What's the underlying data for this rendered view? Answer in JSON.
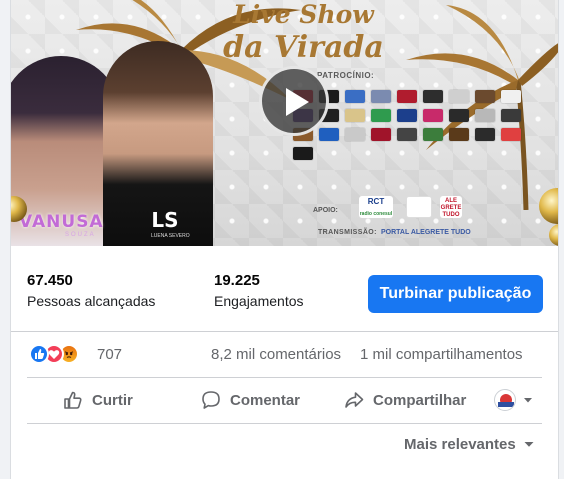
{
  "post": {
    "media": {
      "title_line1": "Live Show",
      "title_line2": "da Virada",
      "sponsor_heading": "PATROCÍNIO:",
      "artist_left": "VANUSA",
      "artist_left_sub": "SOUZA",
      "artist_right_logo": "LS",
      "artist_right_sub": "LUENA SEVERO",
      "support_heading": "APOIO:",
      "broadcast_heading": "TRANSMISSÃO:",
      "broadcast_channel": "PORTAL ALEGRETE TUDO",
      "support_logo_1": "RCT",
      "support_logo_1_sub": "radio conesul",
      "support_logo_3": "ALE GRETE TUDO",
      "play_icon": "play-icon",
      "sponsor_logo_colors": [
        "#c4142b",
        "#1b1b1b",
        "#3a6ec4",
        "#7b8bb0",
        "#b01c2e",
        "#2d2d2d",
        "#cfcfcf",
        "#6b4a2e",
        "#f0f0f0",
        "#4f2d7a",
        "#202020",
        "#d9c48a",
        "#2f9b4e",
        "#1c3f8c",
        "#c82a6a",
        "#2a2a2a",
        "#b8b8b8",
        "#3a3a3a",
        "#8b5a2b",
        "#1f5fbf",
        "#c9c9c9",
        "#a0142a",
        "#444444",
        "#3c7d3c",
        "#5a3a1a",
        "#2b2b2b",
        "#e04040",
        "#1a1a1a"
      ]
    },
    "stats": {
      "reach_value": "67.450",
      "reach_label": "Pessoas alcançadas",
      "engagement_value": "19.225",
      "engagement_label": "Engajamentos",
      "boost_label": "Turbinar publicação"
    },
    "reactions": {
      "icons": [
        "like-reaction-icon",
        "love-reaction-icon",
        "angry-reaction-icon"
      ],
      "count": "707",
      "comments": "8,2 mil comentários",
      "shares": "1 mil compartilhamentos"
    },
    "actions": {
      "like_label": "Curtir",
      "comment_label": "Comentar",
      "share_label": "Compartilhar"
    },
    "sort_label": "Mais relevantes",
    "colors": {
      "primary": "#1877f2",
      "secondary_text": "#65676b",
      "like": "#1877f2",
      "love": "#f33e58",
      "angry": "#e9710f"
    }
  }
}
